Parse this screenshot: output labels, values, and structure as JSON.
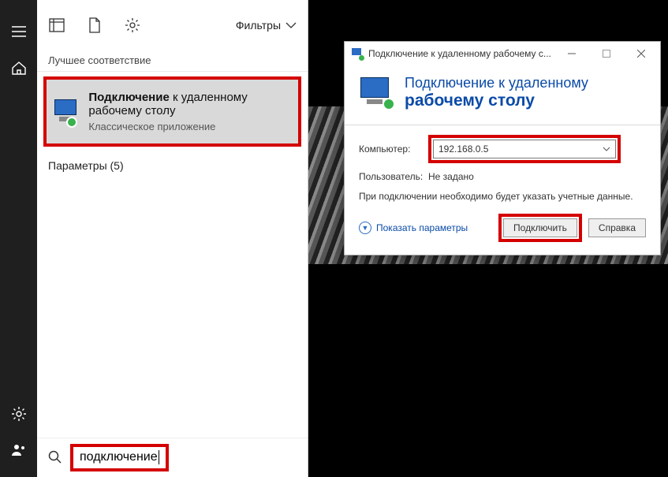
{
  "rail": {
    "icons": [
      "menu-icon",
      "home-icon",
      "gear-icon",
      "user-icon"
    ]
  },
  "searchPanel": {
    "filtersLabel": "Фильтры",
    "bestMatchHeader": "Лучшее соответствие",
    "result": {
      "boldPart": "Подключение",
      "restPart": " к удаленному рабочему столу",
      "subtitle": "Классическое приложение"
    },
    "paramsLabel": "Параметры (5)",
    "searchValue": "подключение"
  },
  "rdp": {
    "windowTitle": "Подключение к удаленному рабочему с...",
    "headerLine1": "Подключение к удаленному",
    "headerLine2": "рабочему столу",
    "computerLabel": "Компьютер:",
    "computerValue": "192.168.0.5",
    "userLabel": "Пользователь:",
    "userValue": "Не задано",
    "note": "При подключении необходимо будет указать учетные данные.",
    "showOptions": "Показать параметры",
    "connectBtn": "Подключить",
    "helpBtn": "Справка"
  },
  "colors": {
    "highlight": "#d40000",
    "accent": "#0a4aa8"
  }
}
